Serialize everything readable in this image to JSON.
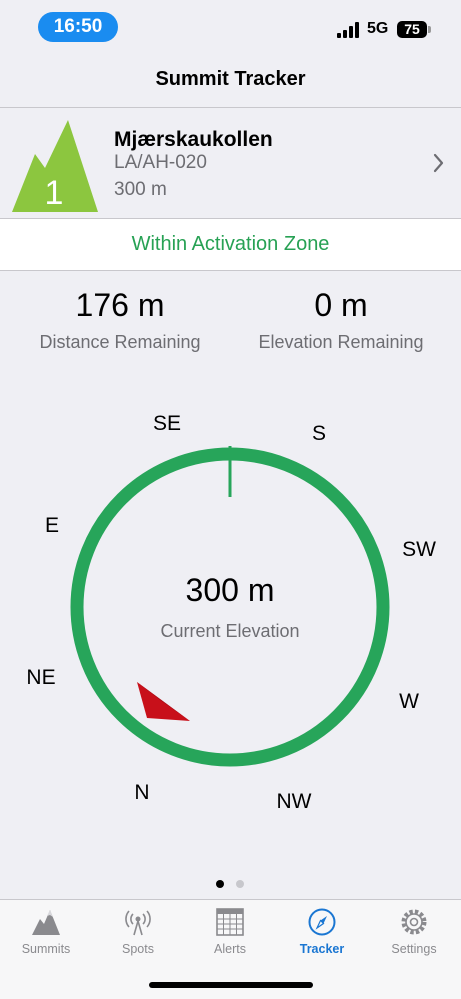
{
  "status_bar": {
    "time": "16:50",
    "network": "5G",
    "battery": "75"
  },
  "nav": {
    "title": "Summit Tracker"
  },
  "summit": {
    "badge_number": "1",
    "name": "Mjærskaukollen",
    "reference": "LA/AH-020",
    "altitude": "300 m",
    "badge_color": "#8cc63f"
  },
  "zone_status": {
    "text": "Within Activation Zone",
    "color": "#27a154"
  },
  "stats": {
    "distance_value": "176 m",
    "distance_label": "Distance Remaining",
    "elevation_value": "0 m",
    "elevation_label": "Elevation Remaining"
  },
  "compass": {
    "center_value": "300 m",
    "center_label": "Current Elevation",
    "ring_color": "#27a55a",
    "pointer_color": "#c8101a",
    "directions": {
      "se": "SE",
      "s": "S",
      "sw": "SW",
      "w": "W",
      "nw": "NW",
      "n": "N",
      "ne": "NE",
      "e": "E"
    }
  },
  "pager": {
    "pages": 2,
    "active": 1
  },
  "tabs": [
    {
      "label": "Summits",
      "icon": "mountain-icon"
    },
    {
      "label": "Spots",
      "icon": "radio-tower-icon"
    },
    {
      "label": "Alerts",
      "icon": "calendar-icon"
    },
    {
      "label": "Tracker",
      "icon": "compass-icon",
      "active": true
    },
    {
      "label": "Settings",
      "icon": "gear-icon"
    }
  ]
}
